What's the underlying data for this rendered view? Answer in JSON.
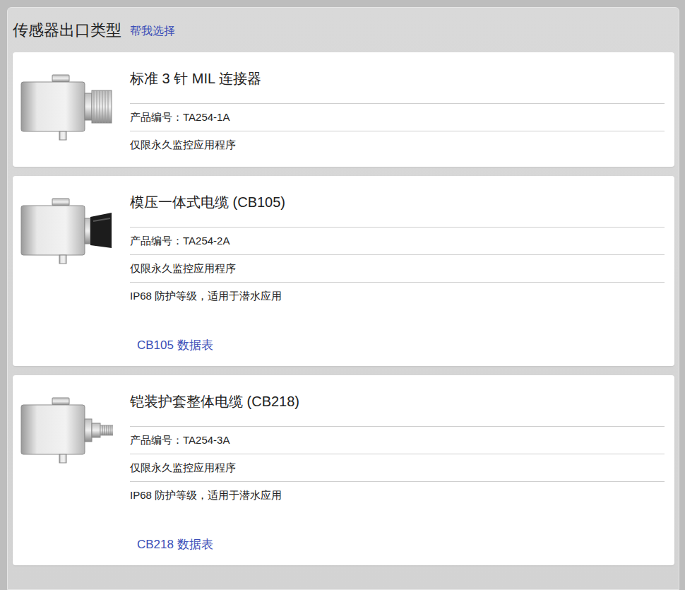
{
  "header": {
    "title": "传感器出口类型",
    "help_link": "帮我选择"
  },
  "options": [
    {
      "kind": "connector",
      "title": "标准 3 针 MIL 连接器",
      "rows": [
        "产品编号：TA254-1A",
        "仅限永久监控应用程序"
      ]
    },
    {
      "kind": "molded",
      "title": "模压一体式电缆 (CB105)",
      "rows": [
        "产品编号：TA254-2A",
        "仅限永久监控应用程序",
        "IP68 防护等级，适用于潜水应用"
      ],
      "datasheet": "CB105 数据表"
    },
    {
      "kind": "armored",
      "title": "铠装护套整体电缆 (CB218)",
      "rows": [
        "产品编号：TA254-3A",
        "仅限永久监控应用程序",
        "IP68 防护等级，适用于潜水应用"
      ],
      "datasheet": "CB218 数据表"
    }
  ]
}
